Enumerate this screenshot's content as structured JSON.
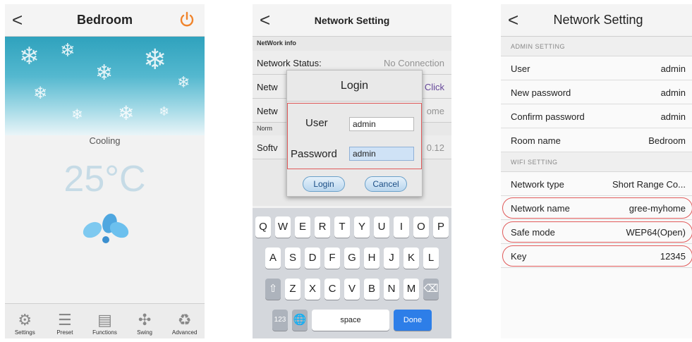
{
  "screen1": {
    "back": "<",
    "title": "Bedroom",
    "power_icon": "power-icon",
    "mode": "Cooling",
    "temperature": "25°C",
    "tabs": [
      {
        "label": "Settings",
        "icon": "gear-icon"
      },
      {
        "label": "Preset",
        "icon": "list-icon"
      },
      {
        "label": "Functions",
        "icon": "document-icon"
      },
      {
        "label": "Swing",
        "icon": "swing-icon"
      },
      {
        "label": "Advanced",
        "icon": "recycle-icon"
      }
    ]
  },
  "screen2": {
    "back": "<",
    "title": "Network Setting",
    "section_info": "NetWork info",
    "rows": [
      {
        "label": "Network Status:",
        "value": "No Connection"
      },
      {
        "label": "Netw",
        "value": "Click"
      },
      {
        "label": "Netw",
        "value": "ome"
      }
    ],
    "section_norm": "Norm",
    "soft_row": {
      "label": "Softv",
      "value": "0.12"
    },
    "dialog": {
      "title": "Login",
      "user_label": "User",
      "user_value": "admin",
      "password_label": "Password",
      "password_value": "admin",
      "login_button": "Login",
      "cancel_button": "Cancel"
    },
    "keyboard": {
      "row1": [
        "Q",
        "W",
        "E",
        "R",
        "T",
        "Y",
        "U",
        "I",
        "O",
        "P"
      ],
      "row2": [
        "A",
        "S",
        "D",
        "F",
        "G",
        "H",
        "J",
        "K",
        "L"
      ],
      "row3": [
        "Z",
        "X",
        "C",
        "V",
        "B",
        "N",
        "M"
      ],
      "numbers": "123",
      "space": "space",
      "done": "Done"
    }
  },
  "screen3": {
    "back": "<",
    "title": "Network Setting",
    "admin_section": "ADMIN SETTING",
    "admin_rows": [
      {
        "label": "User",
        "value": "admin"
      },
      {
        "label": "New password",
        "value": "admin"
      },
      {
        "label": "Confirm password",
        "value": "admin"
      },
      {
        "label": "Room name",
        "value": "Bedroom"
      }
    ],
    "wifi_section": "WIFI SETTING",
    "wifi_rows": [
      {
        "label": "Network type",
        "value": "Short Range Co..."
      },
      {
        "label": "Network name",
        "value": "gree-myhome"
      },
      {
        "label": "Safe mode",
        "value": "WEP64(Open)"
      },
      {
        "label": "Key",
        "value": "12345"
      }
    ]
  },
  "colors": {
    "accent_orange": "#f0842c",
    "highlight_red": "#e05a5a",
    "done_blue": "#2d7ee8"
  }
}
